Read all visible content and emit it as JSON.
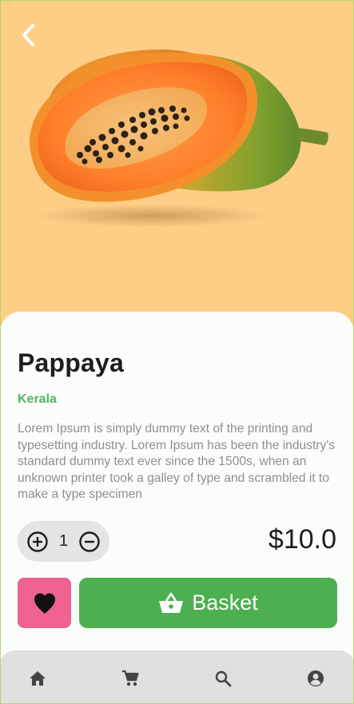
{
  "header": {
    "back_icon": "chevron-left-icon"
  },
  "hero": {
    "background_color": "#fecd86",
    "image": "papaya-fruit-image"
  },
  "product": {
    "name": "Pappaya",
    "origin": "Kerala",
    "description": "Lorem Ipsum is simply dummy text of the printing and typesetting industry. Lorem Ipsum has been the industry's standard dummy text ever since the 1500s, when an unknown printer took a galley of type and scrambled it to make a type specimen",
    "price": "$10.0"
  },
  "quantity": {
    "value": "1",
    "increment_icon": "plus-circle-icon",
    "decrement_icon": "minus-circle-icon"
  },
  "actions": {
    "favorite_icon": "heart-icon",
    "basket_label": "Basket",
    "basket_icon": "basket-icon"
  },
  "bottom_nav": {
    "items": [
      {
        "icon": "home-icon"
      },
      {
        "icon": "cart-icon"
      },
      {
        "icon": "search-icon"
      },
      {
        "icon": "account-icon"
      }
    ]
  },
  "colors": {
    "accent_green": "#4caf50",
    "origin_green": "#53b461",
    "favorite_pink": "#f06292",
    "nav_background": "#e0e0e0"
  }
}
